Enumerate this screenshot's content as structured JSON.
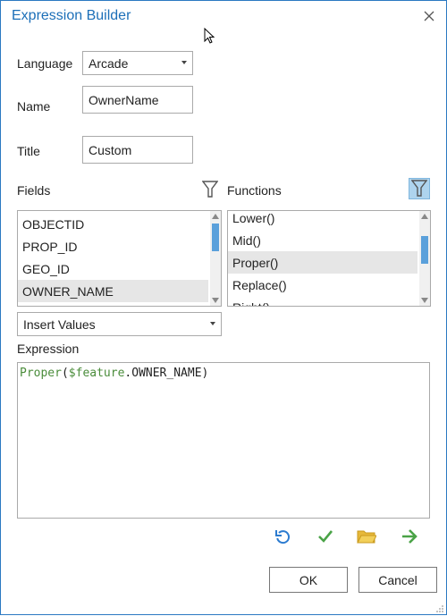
{
  "dialog": {
    "title": "Expression Builder"
  },
  "language": {
    "label": "Language",
    "value": "Arcade"
  },
  "name": {
    "label": "Name",
    "value": "OwnerName"
  },
  "title_field": {
    "label": "Title",
    "value": "Custom"
  },
  "fields": {
    "label": "Fields",
    "items": [
      "OBJECTID",
      "PROP_ID",
      "GEO_ID",
      "OWNER_NAME"
    ],
    "selected": "OWNER_NAME",
    "scroll_position": 0.9
  },
  "functions": {
    "label": "Functions",
    "items": [
      "Lower()",
      "Mid()",
      "Proper()",
      "Replace()",
      "Right()"
    ],
    "selected": "Proper()",
    "filter_active": true,
    "scroll_position": 0.5
  },
  "insert_values": {
    "value": "Insert Values"
  },
  "expression": {
    "label": "Expression",
    "tokens": [
      {
        "text": "Proper",
        "kind": "fn"
      },
      {
        "text": "(",
        "kind": "plain"
      },
      {
        "text": "$feature",
        "kind": "fn"
      },
      {
        "text": ".OWNER_NAME)",
        "kind": "plain"
      }
    ]
  },
  "toolbar": {
    "icons": [
      "undo-icon",
      "check-icon",
      "folder-icon",
      "arrow-right-icon"
    ],
    "colors": {
      "undo": "#2b7bd0",
      "check": "#4aa347",
      "folder": "#e6b83a",
      "arrow": "#4aa347"
    }
  },
  "buttons": {
    "ok": "OK",
    "cancel": "Cancel"
  },
  "accent": "#1c6fb8"
}
